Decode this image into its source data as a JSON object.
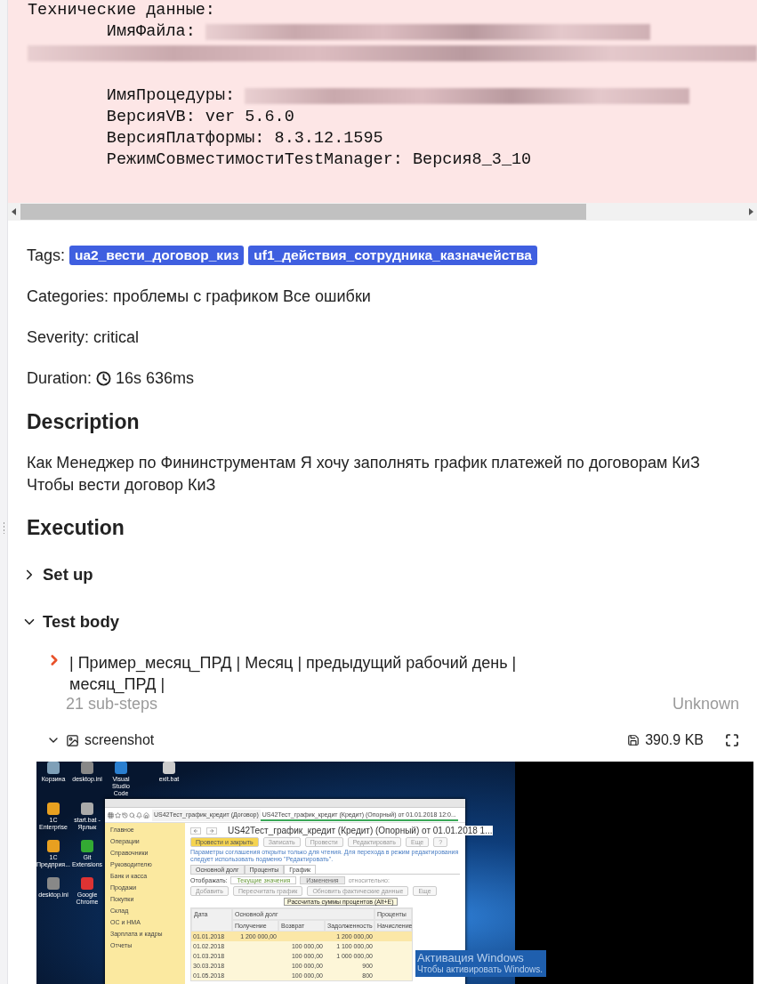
{
  "technical_data": {
    "heading": "Технические данные:",
    "lines": [
      {
        "kind": "redacted_field",
        "label": "ИмяФайла:"
      },
      {
        "kind": "redacted_line"
      },
      {
        "kind": "blank"
      },
      {
        "kind": "redacted_field",
        "label": "ИмяПроцедуры:"
      },
      {
        "kind": "text",
        "text": "ВерсияVB: ver 5.6.0"
      },
      {
        "kind": "text",
        "text": "ВерсияПлатформы: 8.3.12.1595"
      },
      {
        "kind": "text",
        "text": "РежимСовместимостиTestManager: Версия8_3_10"
      }
    ]
  },
  "tags": {
    "label": "Tags:",
    "items": [
      "ua2_вести_договор_киз",
      "uf1_действия_сотрудника_казначейства"
    ]
  },
  "info": [
    {
      "kind": "text",
      "text": "Categories: проблемы с графиком Все ошибки"
    },
    {
      "kind": "text",
      "text": "Severity: critical"
    },
    {
      "kind": "duration",
      "label": "Duration:",
      "value": "16s 636ms"
    }
  ],
  "description": {
    "heading": "Description",
    "text": "Как Менеджер по Фининструментам Я хочу заполнять график платежей по договорам КиЗ Чтобы вести договор КиЗ"
  },
  "execution": {
    "heading": "Execution",
    "sections": [
      {
        "title": "Set up",
        "expanded": false
      },
      {
        "title": "Test body",
        "expanded": true,
        "steps": [
          {
            "text": "| Пример_месяц_ПРД | Месяц | предыдущий рабочий день | месяц_ПРД |",
            "substeps": "21 sub-steps",
            "status": "Unknown",
            "expanded": false
          }
        ],
        "attachments": [
          {
            "name": "screenshot",
            "size": "390.9 KB",
            "expanded": true,
            "screenshot": {
              "desktop_icons": [
                "Корзина",
                "desktop.ini",
                "Visual Studio Code",
                "exit.bat",
                "1C Enterprise",
                "start.bat - Ярлык",
                "1C Предприя...",
                "Git Extensions",
                "desktop.ini",
                "Google Chrome"
              ],
              "window": {
                "tabs": [
                  {
                    "label": "US42Тест_график_кредит (Договор)",
                    "selected": false
                  },
                  {
                    "label": "US42Тест_график_кредит (Кредит) (Опорный) от 01.01.2018 12:0...",
                    "selected": true
                  }
                ],
                "sidebar": [
                  "Главное",
                  "Операции",
                  "Справочники",
                  "Руководителю",
                  "Банк и касса",
                  "Продажи",
                  "Покупки",
                  "Склад",
                  "ОС и НМА",
                  "Зарплата и кадры",
                  "Отчеты"
                ],
                "title": "US42Тест_график_кредит (Кредит) (Опорный) от 01.01.2018 1...",
                "buttons": [
                  {
                    "label": "Провести и закрыть",
                    "primary": true
                  },
                  {
                    "label": "Записать",
                    "primary": false
                  },
                  {
                    "label": "Провести",
                    "primary": false
                  },
                  {
                    "label": "Редактировать",
                    "primary": false
                  },
                  {
                    "label": "Еще",
                    "primary": false
                  },
                  {
                    "label": "?",
                    "primary": false
                  }
                ],
                "notice": "Параметры соглашения открыты только для чтения. Для перехода в режим редактирования следует использовать подменю \"Редактировать\".",
                "doc_tabs": [
                  {
                    "label": "Основной долг",
                    "selected": false
                  },
                  {
                    "label": "Проценты",
                    "selected": false
                  },
                  {
                    "label": "График",
                    "selected": true
                  }
                ],
                "display_label": "Отображать:",
                "display_options": [
                  {
                    "label": "Текущие значения",
                    "selected": true
                  },
                  {
                    "label": "Изменения",
                    "selected": false
                  }
                ],
                "relative_label": "относительно:",
                "actions": [
                  "Добавить",
                  "Пересчитать график",
                  "Обновить фактические данные",
                  "Еще"
                ],
                "tooltip": "Рассчитать суммы процентов (Alt+E)",
                "table": {
                  "date_header": "Дата",
                  "group_headers": [
                    "Основной долг",
                    "Проценты"
                  ],
                  "columns": [
                    "Получение",
                    "Возврат",
                    "Задолженность",
                    "Начисление"
                  ],
                  "rows": [
                    {
                      "date": "01.01.2018",
                      "receipt": "1 200 000,00",
                      "debt": "1 200 000,00",
                      "selected": true
                    },
                    {
                      "date": "01.02.2018",
                      "repayment": "100 000,00",
                      "debt": "1 100 000,00",
                      "selected": false
                    },
                    {
                      "date": "01.03.2018",
                      "repayment": "100 000,00",
                      "debt": "1 000 000,00",
                      "selected": false
                    },
                    {
                      "date": "30.03.2018",
                      "repayment": "100 000,00",
                      "debt": "900",
                      "selected": false
                    },
                    {
                      "date": "01.05.2018",
                      "repayment": "100 000,00",
                      "debt": "800",
                      "selected": false
                    }
                  ]
                }
              },
              "activation": {
                "title": "Активация Windows",
                "text": "Чтобы активировать Windows."
              }
            }
          }
        ]
      }
    ]
  }
}
